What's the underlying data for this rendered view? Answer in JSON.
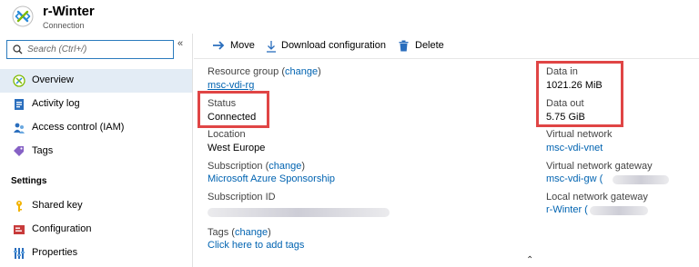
{
  "header": {
    "title": "r-Winter",
    "subtitle": "Connection",
    "icon": "connection-icon"
  },
  "sidebar": {
    "search_placeholder": "Search (Ctrl+/)",
    "collapse_glyph": "«",
    "items": [
      {
        "label": "Overview",
        "icon": "overview-icon",
        "active": true
      },
      {
        "label": "Activity log",
        "icon": "activity-log-icon"
      },
      {
        "label": "Access control (IAM)",
        "icon": "iam-icon"
      },
      {
        "label": "Tags",
        "icon": "tag-icon"
      }
    ],
    "settings_heading": "Settings",
    "settings_items": [
      {
        "label": "Shared key",
        "icon": "key-icon"
      },
      {
        "label": "Configuration",
        "icon": "configuration-icon"
      },
      {
        "label": "Properties",
        "icon": "properties-icon"
      }
    ]
  },
  "toolbar": {
    "move_label": "Move",
    "download_label": "Download configuration",
    "delete_label": "Delete"
  },
  "essentials": {
    "resource_group_label": "Resource group",
    "change_link": "change",
    "resource_group_value": "msc-vdi-rg",
    "status_label": "Status",
    "status_value": "Connected",
    "location_label": "Location",
    "location_value": "West Europe",
    "subscription_label": "Subscription",
    "subscription_value": "Microsoft Azure Sponsorship",
    "subscription_id_label": "Subscription ID",
    "tags_label": "Tags",
    "tags_value": "Click here to add tags",
    "data_in_label": "Data in",
    "data_in_value": "1021.26 MiB",
    "data_out_label": "Data out",
    "data_out_value": "5.75 GiB",
    "vnet_label": "Virtual network",
    "vnet_value": "msc-vdi-vnet",
    "vnet_gateway_label": "Virtual network gateway",
    "vnet_gateway_value": "msc-vdi-gw (",
    "local_gateway_label": "Local network gateway",
    "local_gateway_value": "r-Winter (",
    "expand_glyph": "⌃"
  },
  "colors": {
    "link": "#0063b1",
    "highlight_box": "#e04545",
    "active_nav": "#e3ecf5"
  }
}
